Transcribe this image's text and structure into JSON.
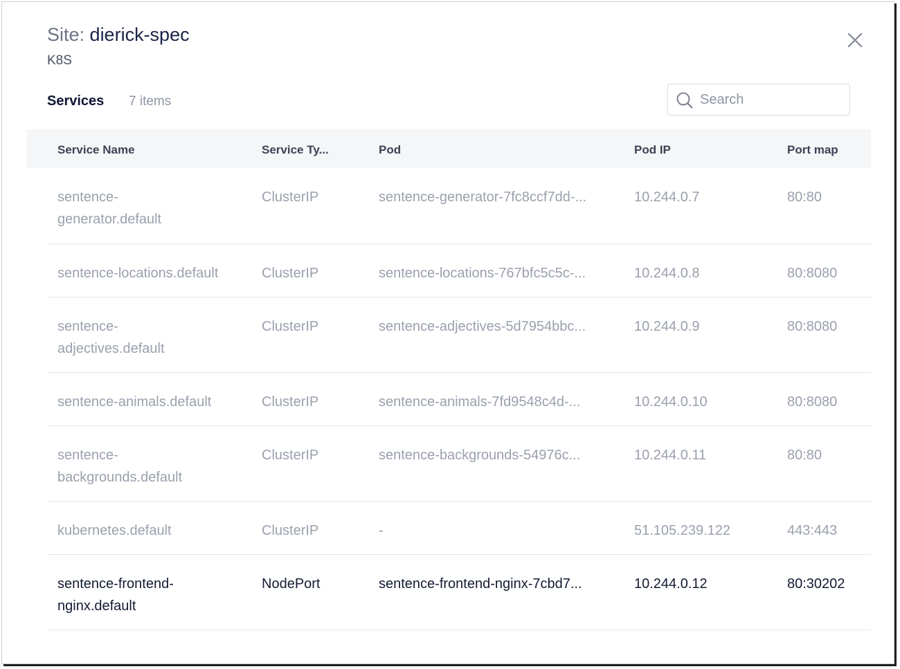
{
  "header": {
    "title_prefix": "Site:",
    "title_name": "dierick-spec",
    "subtitle": "K8S"
  },
  "section": {
    "title": "Services",
    "count": "7 items"
  },
  "search": {
    "placeholder": "Search"
  },
  "table": {
    "columns": [
      "Service Name",
      "Service Ty...",
      "Pod",
      "Pod IP",
      "Port map"
    ],
    "rows": [
      {
        "name_line1": "sentence-",
        "name_line2": "generator.default",
        "type": "ClusterIP",
        "pod": "sentence-generator-7fc8ccf7dd-...",
        "ip": "10.244.0.7",
        "ports": "80:80"
      },
      {
        "name_line1": "sentence-locations.default",
        "name_line2": "",
        "type": "ClusterIP",
        "pod": "sentence-locations-767bfc5c5c-...",
        "ip": "10.244.0.8",
        "ports": "80:8080"
      },
      {
        "name_line1": "sentence-",
        "name_line2": "adjectives.default",
        "type": "ClusterIP",
        "pod": "sentence-adjectives-5d7954bbc...",
        "ip": "10.244.0.9",
        "ports": "80:8080"
      },
      {
        "name_line1": "sentence-animals.default",
        "name_line2": "",
        "type": "ClusterIP",
        "pod": "sentence-animals-7fd9548c4d-...",
        "ip": "10.244.0.10",
        "ports": "80:8080"
      },
      {
        "name_line1": "sentence-",
        "name_line2": "backgrounds.default",
        "type": "ClusterIP",
        "pod": "sentence-backgrounds-54976c...",
        "ip": "10.244.0.11",
        "ports": "80:80"
      },
      {
        "name_line1": "kubernetes.default",
        "name_line2": "",
        "type": "ClusterIP",
        "pod": "-",
        "ip": "51.105.239.122",
        "ports": "443:443"
      },
      {
        "name_line1": "sentence-frontend-",
        "name_line2": "nginx.default",
        "type": "NodePort",
        "pod": "sentence-frontend-nginx-7cbd7...",
        "ip": "10.244.0.12",
        "ports": "80:30202"
      }
    ]
  },
  "colors": {
    "title": "#1b2346",
    "muted_text": "#9aa0ad",
    "active_text": "#131a33",
    "header_bg": "#f5f6f8",
    "divider": "#e3e5ea"
  }
}
